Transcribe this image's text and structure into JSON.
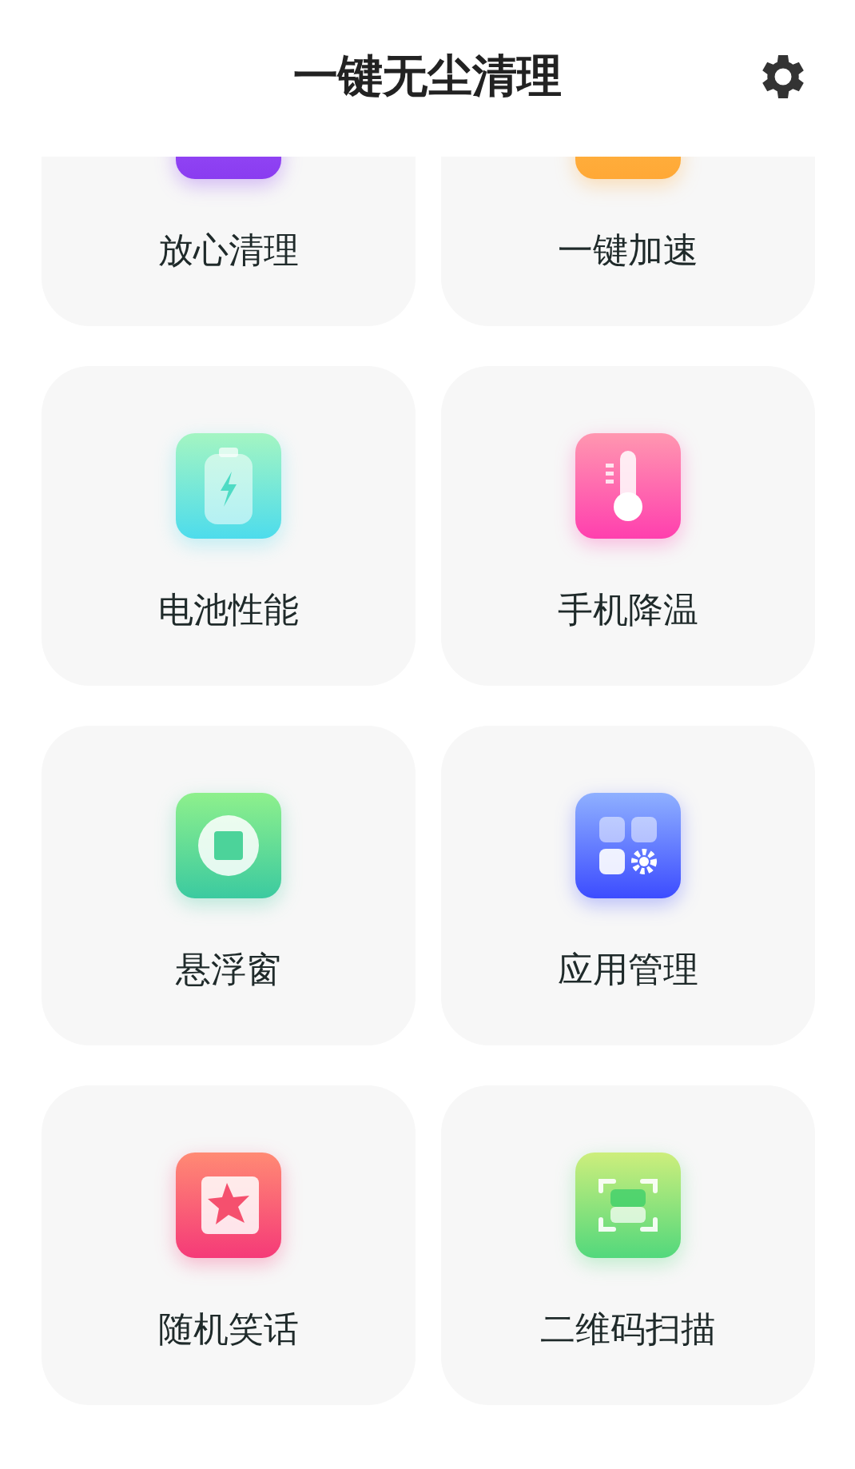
{
  "header": {
    "title": "一键无尘清理"
  },
  "tools": [
    {
      "label": "放心清理",
      "kind": "clean"
    },
    {
      "label": "一键加速",
      "kind": "boost"
    },
    {
      "label": "电池性能",
      "kind": "battery"
    },
    {
      "label": "手机降温",
      "kind": "thermo"
    },
    {
      "label": "悬浮窗",
      "kind": "float"
    },
    {
      "label": "应用管理",
      "kind": "apps"
    },
    {
      "label": "随机笑话",
      "kind": "joke"
    },
    {
      "label": "二维码扫描",
      "kind": "scan"
    }
  ]
}
